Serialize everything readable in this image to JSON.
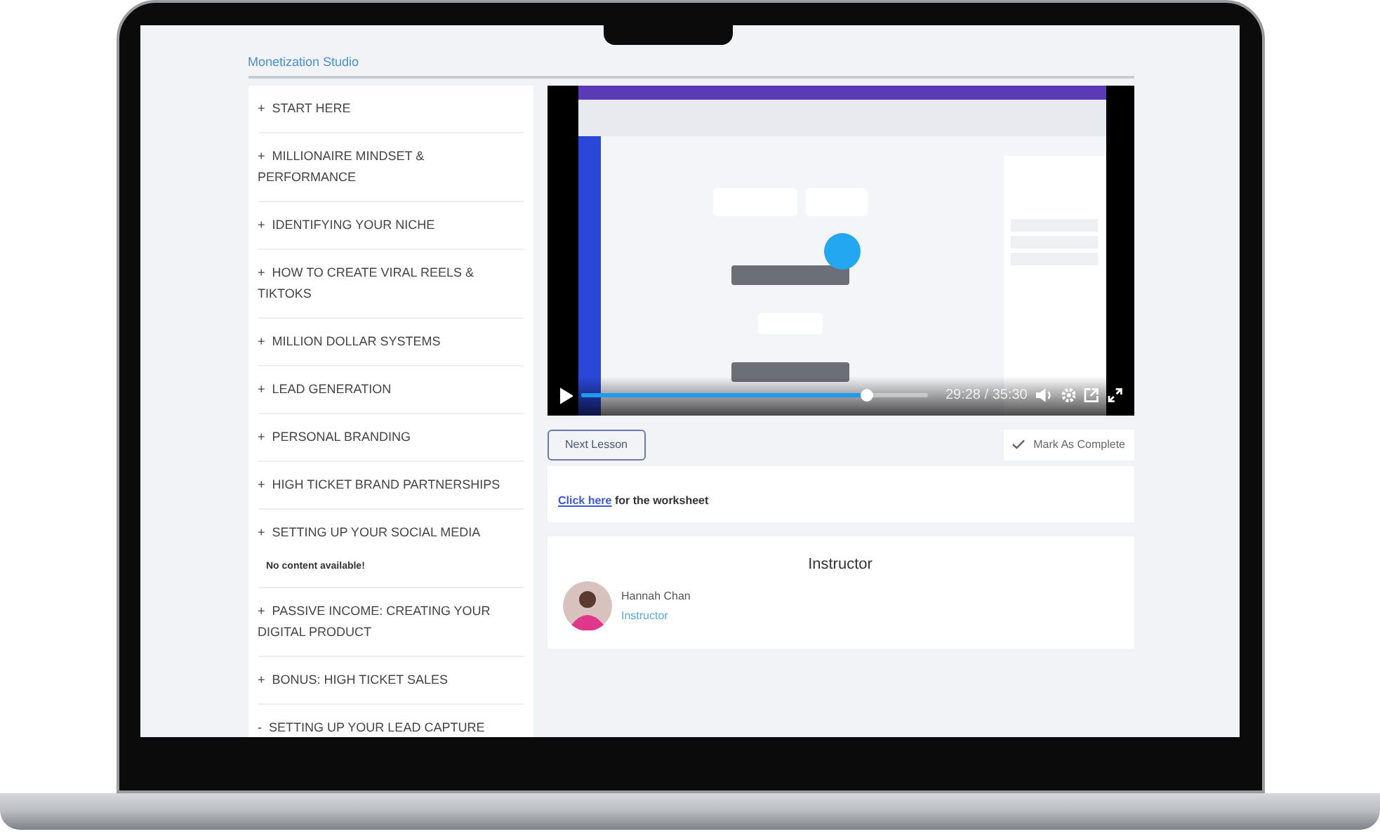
{
  "header": {
    "title": "Monetization Studio"
  },
  "modules": [
    {
      "sign": "+",
      "title": "START HERE"
    },
    {
      "sign": "+",
      "title": "MILLIONAIRE MINDSET & PERFORMANCE"
    },
    {
      "sign": "+",
      "title": "IDENTIFYING YOUR NICHE"
    },
    {
      "sign": "+",
      "title": "HOW TO CREATE VIRAL REELS & TIKTOKS"
    },
    {
      "sign": "+",
      "title": "MILLION DOLLAR SYSTEMS"
    },
    {
      "sign": "+",
      "title": "LEAD GENERATION"
    },
    {
      "sign": "+",
      "title": "PERSONAL BRANDING"
    },
    {
      "sign": "+",
      "title": "HIGH TICKET BRAND PARTNERSHIPS"
    },
    {
      "sign": "+",
      "title": "SETTING UP YOUR SOCIAL MEDIA",
      "note": "No content available!"
    },
    {
      "sign": "+",
      "title": "PASSIVE INCOME: CREATING YOUR DIGITAL PRODUCT"
    },
    {
      "sign": "+",
      "title": "BONUS: HIGH TICKET SALES"
    },
    {
      "sign": "-",
      "title": "SETTING UP YOUR LEAD CAPTURE"
    }
  ],
  "video": {
    "progress": {
      "level": 0.82
    },
    "time": "29:28 / 35:30"
  },
  "actions": {
    "next_button": "Next Lesson",
    "complete_button": "Mark As Complete"
  },
  "worksheet": {
    "link": "Click here",
    "text": "for the worksheet"
  },
  "instructor": {
    "heading": "Instructor",
    "name": "Hannah Chan",
    "role": "Instructor"
  }
}
